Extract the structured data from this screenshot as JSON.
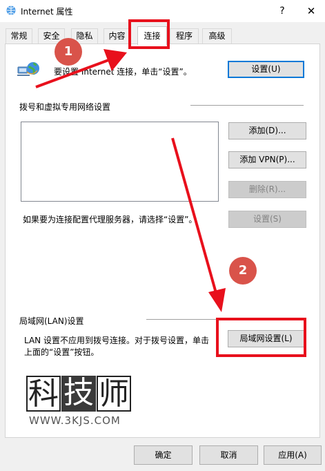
{
  "window": {
    "title": "Internet 属性",
    "help_symbol": "?",
    "close_symbol": "✕"
  },
  "tabs": [
    {
      "label": "常规"
    },
    {
      "label": "安全"
    },
    {
      "label": "隐私"
    },
    {
      "label": "内容"
    },
    {
      "label": "连接"
    },
    {
      "label": "程序"
    },
    {
      "label": "高级"
    }
  ],
  "active_tab": "连接",
  "setup": {
    "text": "要设置 Internet 连接，单击“设置”。",
    "button": "设置(U)"
  },
  "dialup": {
    "heading": "拨号和虚拟专用网络设置",
    "add_button": "添加(D)...",
    "add_vpn_button": "添加 VPN(P)...",
    "remove_button": "删除(R)...",
    "settings_button": "设置(S)",
    "proxy_text": "如果要为连接配置代理服务器，请选择“设置”。"
  },
  "lan": {
    "heading": "局域网(LAN)设置",
    "text_line1": "LAN 设置不应用到拨号连接。对于拨号设置，单击",
    "text_line2": "上面的“设置”按钮。",
    "button": "局域网设置(L)"
  },
  "footer": {
    "ok": "确定",
    "cancel": "取消",
    "apply": "应用(A)"
  },
  "annotations": {
    "badge1": "1",
    "badge2": "2",
    "color": "#e8101c"
  },
  "watermark": {
    "chars": [
      "科",
      "技",
      "师"
    ],
    "url": "WWW.3KJS.COM"
  },
  "icons": {
    "app": "ie-globe-icon",
    "setup": "network-globe-icon"
  }
}
